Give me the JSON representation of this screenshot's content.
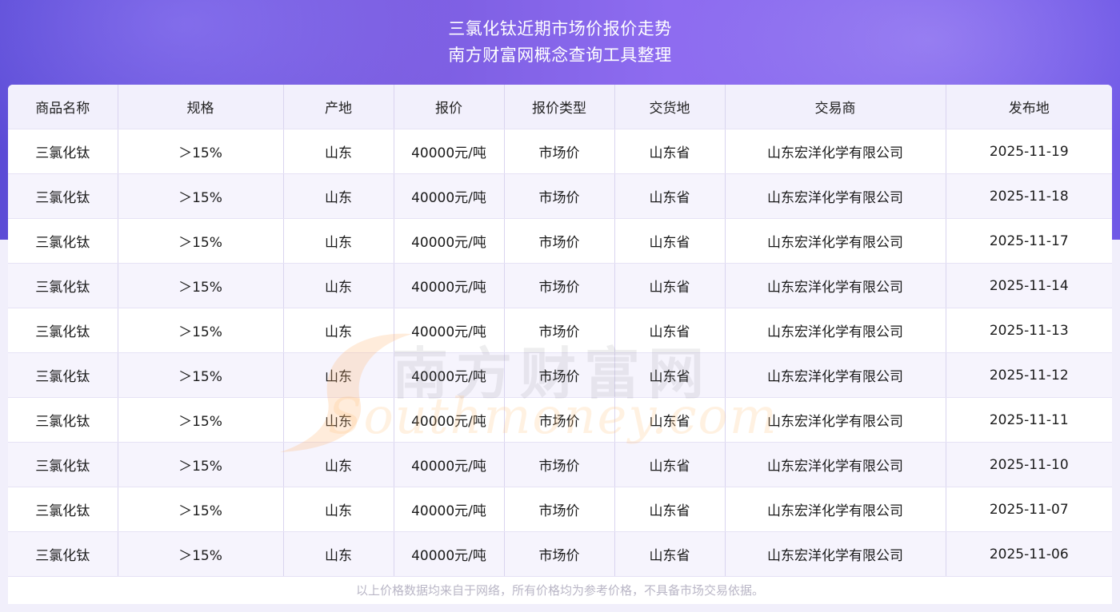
{
  "header": {
    "title_line1": "三氯化钛近期市场价报价走势",
    "title_line2": "南方财富网概念查询工具整理"
  },
  "table": {
    "columns": [
      "商品名称",
      "规格",
      "产地",
      "报价",
      "报价类型",
      "交货地",
      "交易商",
      "发布地"
    ],
    "rows": [
      [
        "三氯化钛",
        "＞15%",
        "山东",
        "40000元/吨",
        "市场价",
        "山东省",
        "山东宏洋化学有限公司",
        "2025-11-19"
      ],
      [
        "三氯化钛",
        "＞15%",
        "山东",
        "40000元/吨",
        "市场价",
        "山东省",
        "山东宏洋化学有限公司",
        "2025-11-18"
      ],
      [
        "三氯化钛",
        "＞15%",
        "山东",
        "40000元/吨",
        "市场价",
        "山东省",
        "山东宏洋化学有限公司",
        "2025-11-17"
      ],
      [
        "三氯化钛",
        "＞15%",
        "山东",
        "40000元/吨",
        "市场价",
        "山东省",
        "山东宏洋化学有限公司",
        "2025-11-14"
      ],
      [
        "三氯化钛",
        "＞15%",
        "山东",
        "40000元/吨",
        "市场价",
        "山东省",
        "山东宏洋化学有限公司",
        "2025-11-13"
      ],
      [
        "三氯化钛",
        "＞15%",
        "山东",
        "40000元/吨",
        "市场价",
        "山东省",
        "山东宏洋化学有限公司",
        "2025-11-12"
      ],
      [
        "三氯化钛",
        "＞15%",
        "山东",
        "40000元/吨",
        "市场价",
        "山东省",
        "山东宏洋化学有限公司",
        "2025-11-11"
      ],
      [
        "三氯化钛",
        "＞15%",
        "山东",
        "40000元/吨",
        "市场价",
        "山东省",
        "山东宏洋化学有限公司",
        "2025-11-10"
      ],
      [
        "三氯化钛",
        "＞15%",
        "山东",
        "40000元/吨",
        "市场价",
        "山东省",
        "山东宏洋化学有限公司",
        "2025-11-07"
      ],
      [
        "三氯化钛",
        "＞15%",
        "山东",
        "40000元/吨",
        "市场价",
        "山东省",
        "山东宏洋化学有限公司",
        "2025-11-06"
      ]
    ]
  },
  "footnote": "以上价格数据均来自于网络，所有价格均为参考价格，不具备市场交易依据。",
  "watermark": {
    "text_cn": "南方财富网",
    "text_en": "Southmoney.com"
  },
  "colors": {
    "header_gradient_start": "#5b4bd6",
    "header_gradient_end": "#8e6cf0",
    "table_header_bg": "#f2f0fc",
    "row_alt_bg": "#f6f4fd",
    "footnote_text": "#b9b6c6"
  }
}
